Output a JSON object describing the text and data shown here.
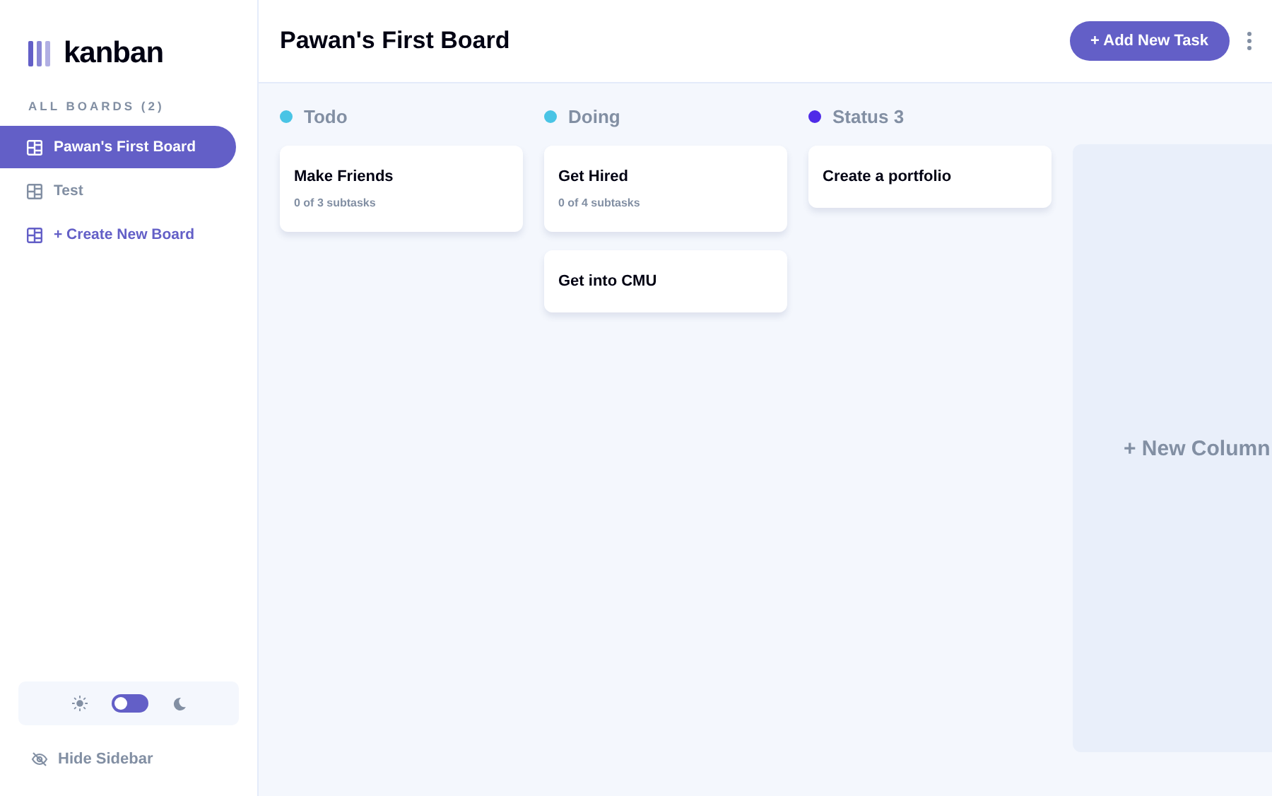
{
  "logo": {
    "text": "kanban"
  },
  "sidebar": {
    "heading": "ALL BOARDS (2)",
    "items": [
      {
        "kind": "board",
        "label": "Pawan's First Board",
        "selected": true
      },
      {
        "kind": "board",
        "label": "Test",
        "selected": false
      },
      {
        "kind": "create",
        "label": "+ Create New Board",
        "selected": false
      }
    ],
    "theme_toggle": {
      "dark_mode": false
    },
    "hide_label": "Hide Sidebar"
  },
  "header": {
    "title": "Pawan's First Board",
    "add_button": "+ Add New Task"
  },
  "columns": [
    {
      "name": "Todo",
      "color": "#49c4e5",
      "tasks": [
        {
          "title": "Make Friends",
          "subtasks": "0 of 3 subtasks"
        }
      ]
    },
    {
      "name": "Doing",
      "color": "#49c4e5",
      "tasks": [
        {
          "title": "Get Hired",
          "subtasks": "0 of 4 subtasks"
        },
        {
          "title": "Get into CMU"
        }
      ]
    },
    {
      "name": "Status 3",
      "color": "#4f2be8",
      "tasks": [
        {
          "title": "Create a portfolio"
        }
      ]
    }
  ],
  "new_column": "+ New Column"
}
